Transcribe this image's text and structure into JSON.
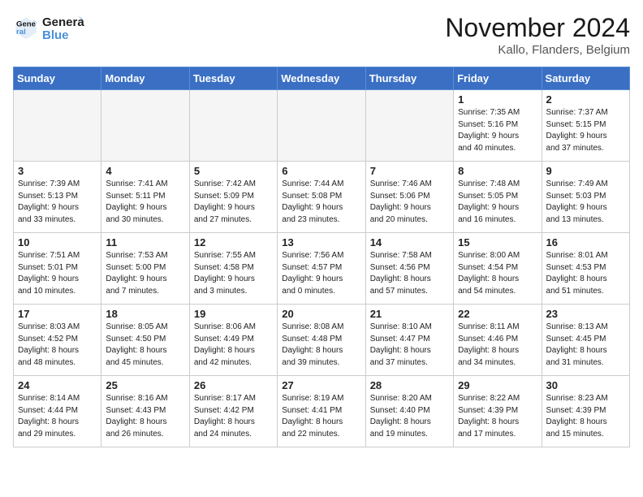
{
  "header": {
    "logo_line1": "General",
    "logo_line2": "Blue",
    "month_title": "November 2024",
    "location": "Kallo, Flanders, Belgium"
  },
  "weekdays": [
    "Sunday",
    "Monday",
    "Tuesday",
    "Wednesday",
    "Thursday",
    "Friday",
    "Saturday"
  ],
  "weeks": [
    [
      {
        "day": "",
        "info": ""
      },
      {
        "day": "",
        "info": ""
      },
      {
        "day": "",
        "info": ""
      },
      {
        "day": "",
        "info": ""
      },
      {
        "day": "",
        "info": ""
      },
      {
        "day": "1",
        "info": "Sunrise: 7:35 AM\nSunset: 5:16 PM\nDaylight: 9 hours\nand 40 minutes."
      },
      {
        "day": "2",
        "info": "Sunrise: 7:37 AM\nSunset: 5:15 PM\nDaylight: 9 hours\nand 37 minutes."
      }
    ],
    [
      {
        "day": "3",
        "info": "Sunrise: 7:39 AM\nSunset: 5:13 PM\nDaylight: 9 hours\nand 33 minutes."
      },
      {
        "day": "4",
        "info": "Sunrise: 7:41 AM\nSunset: 5:11 PM\nDaylight: 9 hours\nand 30 minutes."
      },
      {
        "day": "5",
        "info": "Sunrise: 7:42 AM\nSunset: 5:09 PM\nDaylight: 9 hours\nand 27 minutes."
      },
      {
        "day": "6",
        "info": "Sunrise: 7:44 AM\nSunset: 5:08 PM\nDaylight: 9 hours\nand 23 minutes."
      },
      {
        "day": "7",
        "info": "Sunrise: 7:46 AM\nSunset: 5:06 PM\nDaylight: 9 hours\nand 20 minutes."
      },
      {
        "day": "8",
        "info": "Sunrise: 7:48 AM\nSunset: 5:05 PM\nDaylight: 9 hours\nand 16 minutes."
      },
      {
        "day": "9",
        "info": "Sunrise: 7:49 AM\nSunset: 5:03 PM\nDaylight: 9 hours\nand 13 minutes."
      }
    ],
    [
      {
        "day": "10",
        "info": "Sunrise: 7:51 AM\nSunset: 5:01 PM\nDaylight: 9 hours\nand 10 minutes."
      },
      {
        "day": "11",
        "info": "Sunrise: 7:53 AM\nSunset: 5:00 PM\nDaylight: 9 hours\nand 7 minutes."
      },
      {
        "day": "12",
        "info": "Sunrise: 7:55 AM\nSunset: 4:58 PM\nDaylight: 9 hours\nand 3 minutes."
      },
      {
        "day": "13",
        "info": "Sunrise: 7:56 AM\nSunset: 4:57 PM\nDaylight: 9 hours\nand 0 minutes."
      },
      {
        "day": "14",
        "info": "Sunrise: 7:58 AM\nSunset: 4:56 PM\nDaylight: 8 hours\nand 57 minutes."
      },
      {
        "day": "15",
        "info": "Sunrise: 8:00 AM\nSunset: 4:54 PM\nDaylight: 8 hours\nand 54 minutes."
      },
      {
        "day": "16",
        "info": "Sunrise: 8:01 AM\nSunset: 4:53 PM\nDaylight: 8 hours\nand 51 minutes."
      }
    ],
    [
      {
        "day": "17",
        "info": "Sunrise: 8:03 AM\nSunset: 4:52 PM\nDaylight: 8 hours\nand 48 minutes."
      },
      {
        "day": "18",
        "info": "Sunrise: 8:05 AM\nSunset: 4:50 PM\nDaylight: 8 hours\nand 45 minutes."
      },
      {
        "day": "19",
        "info": "Sunrise: 8:06 AM\nSunset: 4:49 PM\nDaylight: 8 hours\nand 42 minutes."
      },
      {
        "day": "20",
        "info": "Sunrise: 8:08 AM\nSunset: 4:48 PM\nDaylight: 8 hours\nand 39 minutes."
      },
      {
        "day": "21",
        "info": "Sunrise: 8:10 AM\nSunset: 4:47 PM\nDaylight: 8 hours\nand 37 minutes."
      },
      {
        "day": "22",
        "info": "Sunrise: 8:11 AM\nSunset: 4:46 PM\nDaylight: 8 hours\nand 34 minutes."
      },
      {
        "day": "23",
        "info": "Sunrise: 8:13 AM\nSunset: 4:45 PM\nDaylight: 8 hours\nand 31 minutes."
      }
    ],
    [
      {
        "day": "24",
        "info": "Sunrise: 8:14 AM\nSunset: 4:44 PM\nDaylight: 8 hours\nand 29 minutes."
      },
      {
        "day": "25",
        "info": "Sunrise: 8:16 AM\nSunset: 4:43 PM\nDaylight: 8 hours\nand 26 minutes."
      },
      {
        "day": "26",
        "info": "Sunrise: 8:17 AM\nSunset: 4:42 PM\nDaylight: 8 hours\nand 24 minutes."
      },
      {
        "day": "27",
        "info": "Sunrise: 8:19 AM\nSunset: 4:41 PM\nDaylight: 8 hours\nand 22 minutes."
      },
      {
        "day": "28",
        "info": "Sunrise: 8:20 AM\nSunset: 4:40 PM\nDaylight: 8 hours\nand 19 minutes."
      },
      {
        "day": "29",
        "info": "Sunrise: 8:22 AM\nSunset: 4:39 PM\nDaylight: 8 hours\nand 17 minutes."
      },
      {
        "day": "30",
        "info": "Sunrise: 8:23 AM\nSunset: 4:39 PM\nDaylight: 8 hours\nand 15 minutes."
      }
    ]
  ]
}
